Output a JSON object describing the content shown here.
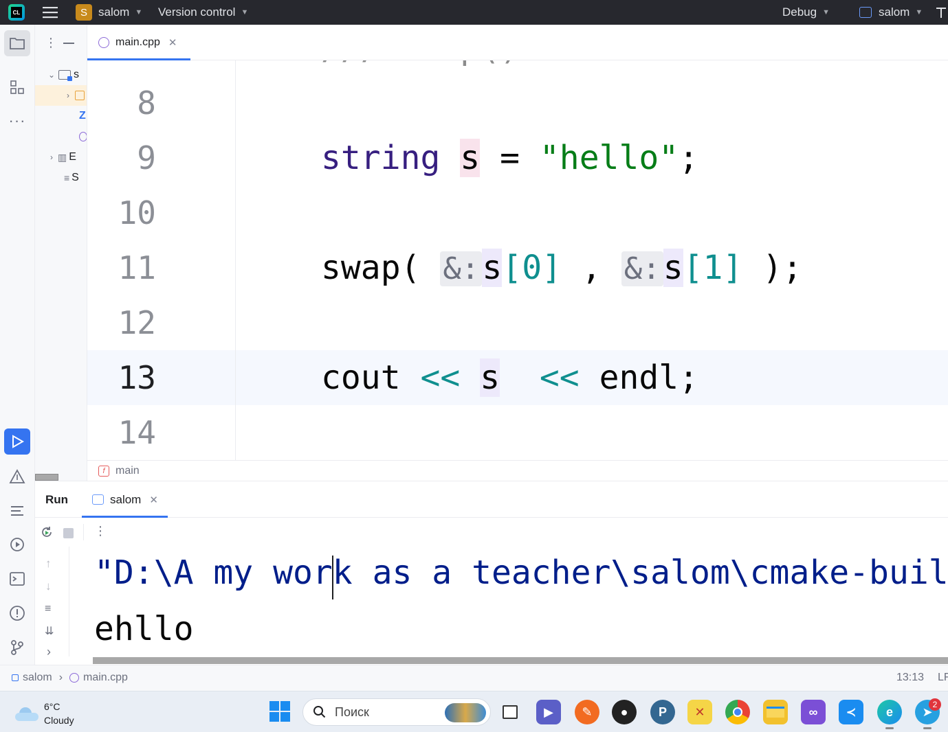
{
  "titlebar": {
    "project_badge": "S",
    "project_name": "salom",
    "vcs_label": "Version control",
    "config_label": "Debug",
    "target_label": "salom"
  },
  "project_tree": {
    "items": [
      {
        "label": "s"
      },
      {
        "label": ""
      },
      {
        "label": ""
      },
      {
        "label": ""
      },
      {
        "label": "E"
      },
      {
        "label": "S"
      }
    ]
  },
  "editor": {
    "tab_label": "main.cpp",
    "top_partial_comment": "/// swap()",
    "line_numbers": [
      "8",
      "9",
      "10",
      "11",
      "12",
      "13",
      "14"
    ],
    "current_line": "13",
    "code": {
      "l9_type": "string",
      "l9_var": "s",
      "l9_eq": " = ",
      "l9_str": "\"hello\"",
      "l9_semi": ";",
      "l11_fn": "swap(",
      "l11_hint1": "&:",
      "l11_s1": "s",
      "l11_idx1": "[0]",
      "l11_comma": " , ",
      "l11_hint2": "&:",
      "l11_s2": "s",
      "l11_idx2": "[1]",
      "l11_end": " );",
      "l13_cout": "cout",
      "l13_op1": " << ",
      "l13_s": "s",
      "l13_op2": "  << ",
      "l13_endl": "endl;"
    },
    "breadcrumb_fn": "main"
  },
  "run_panel": {
    "title": "Run",
    "tab_label": "salom",
    "console_lines": [
      "\"D:\\A my work as a teacher\\salom\\cmake-buil",
      "ehllo"
    ]
  },
  "statusbar": {
    "project": "salom",
    "file": "main.cpp",
    "position": "13:13",
    "line_ending": "LF"
  },
  "taskbar": {
    "weather_temp": "6°C",
    "weather_desc": "Cloudy",
    "search_placeholder": "Поиск",
    "telegram_badge": "2"
  },
  "colors": {
    "accent": "#3574f0",
    "titlebar_bg": "#27282e",
    "string_green": "#067d17",
    "keyword_blue": "#0033b3"
  }
}
